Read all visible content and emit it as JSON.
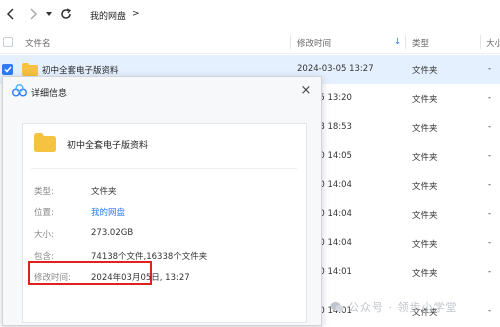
{
  "toolbar": {
    "breadcrumb": "我的网盘",
    "breadcrumb_arrow": ">"
  },
  "header": {
    "name": "文件名",
    "date": "修改时间",
    "type": "类型",
    "size": "大小"
  },
  "rows": [
    {
      "name": "初中全套电子版资料",
      "date": "2024-03-05 13:27",
      "type": "文件夹",
      "size": "-"
    },
    {
      "name": "",
      "date": "-03-05 13:20",
      "type": "文件夹",
      "size": "-"
    },
    {
      "name": "",
      "date": "-02-28 18:53",
      "type": "文件夹",
      "size": "-"
    },
    {
      "name": "",
      "date": "-02-20 14:05",
      "type": "文件夹",
      "size": "-"
    },
    {
      "name": "",
      "date": "-02-20 14:04",
      "type": "文件夹",
      "size": "-"
    },
    {
      "name": "",
      "date": "-02-20 14:04",
      "type": "文件夹",
      "size": "-"
    },
    {
      "name": "",
      "date": "-02-20 14:04",
      "type": "文件夹",
      "size": "-"
    },
    {
      "name": "",
      "date": "-02-20 14:01",
      "type": "文件夹",
      "size": "-"
    },
    {
      "name": "",
      "date": "-02-20 14:01",
      "type": "文件夹",
      "size": "-"
    }
  ],
  "dialog": {
    "title": "详细信息",
    "close": "×",
    "folder_name": "初中全套电子版资料",
    "props": [
      {
        "label": "类型:",
        "value": "文件夹"
      },
      {
        "label": "位置:",
        "value": "我的网盘"
      },
      {
        "label": "大小:",
        "value": "273.02GB"
      },
      {
        "label": "包含:",
        "value": "74138个文件,16338个文件夹"
      },
      {
        "label": "修改时间:",
        "value": "2024年03月05日, 13:27"
      }
    ]
  },
  "watermark": {
    "text": "公众号 · 领步小学堂"
  },
  "colors": {
    "selected_row": "#e5f0ff",
    "accent": "#2d7cf5",
    "folder": "#f5c242",
    "highlight": "#e0211e"
  }
}
